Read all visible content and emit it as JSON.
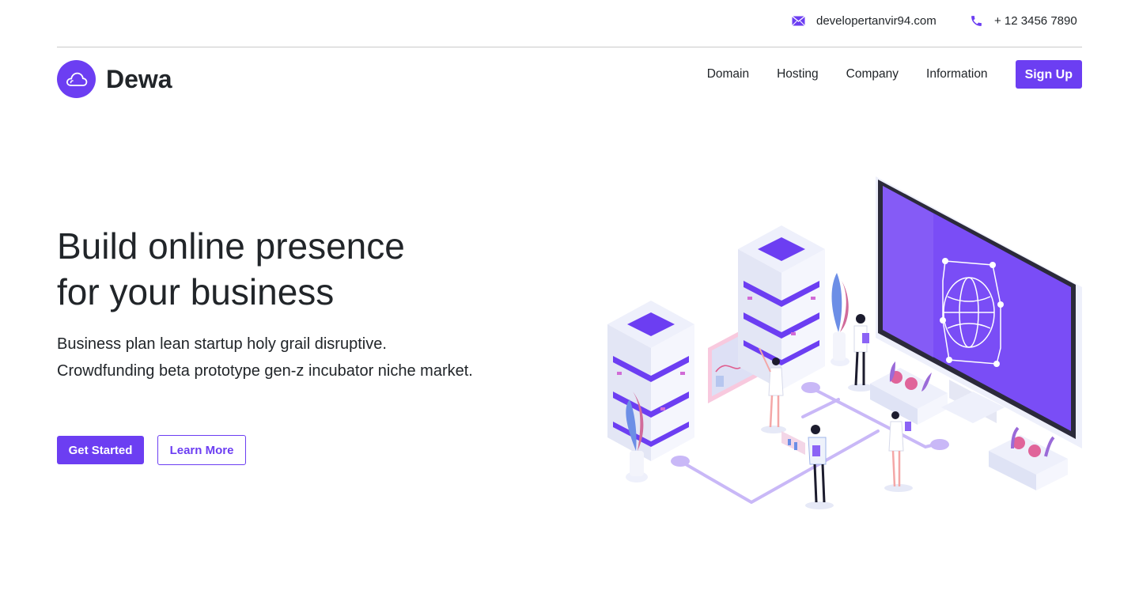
{
  "topbar": {
    "email": "developertanvir94.com",
    "email_icon": "envelope-icon",
    "phone": "+ 12 3456 7890",
    "phone_icon": "phone-icon"
  },
  "brand": {
    "name": "Dewa",
    "logo_icon": "cloud-icon"
  },
  "nav": {
    "links": [
      "Domain",
      "Hosting",
      "Company",
      "Information"
    ],
    "signup": "Sign Up"
  },
  "hero": {
    "title_line1": "Build online presence",
    "title_line2": "for your business",
    "text": "Business plan lean startup holy grail disruptive. Crowdfunding beta prototype gen-z incubator niche market.",
    "primary_button": "Get Started",
    "secondary_button": "Learn More"
  },
  "colors": {
    "accent": "#6c3ef2",
    "text": "#212529"
  }
}
